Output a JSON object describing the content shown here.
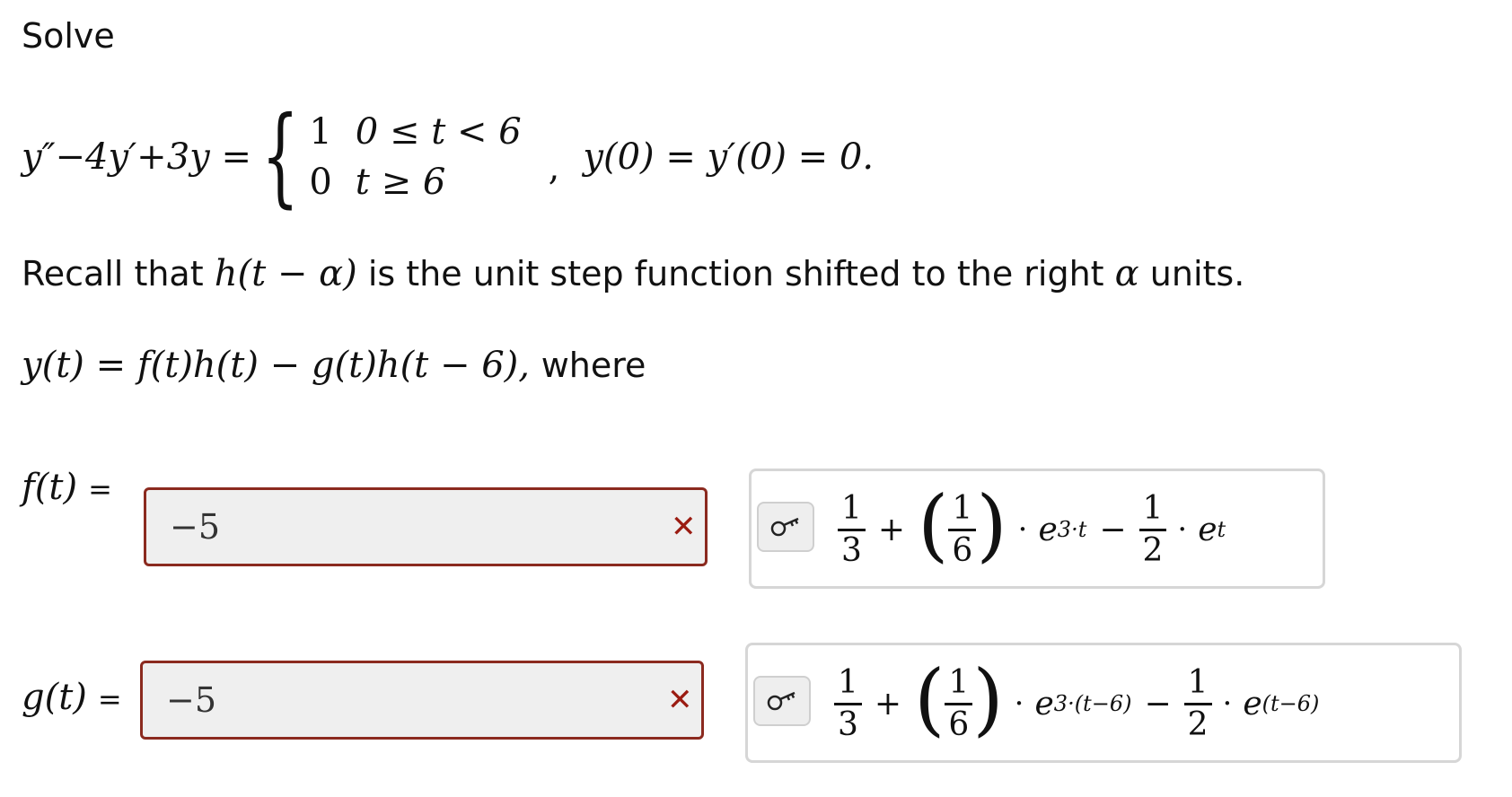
{
  "heading": "Solve",
  "ode": {
    "lhs": "y″−4y′+3y =",
    "cases": [
      {
        "value": "1",
        "condition": "0 ≤ t < 6"
      },
      {
        "value": "0",
        "condition": "t ≥ 6"
      }
    ],
    "separator": ",",
    "initial_conditions": "y(0) = y′(0) = 0."
  },
  "recall": {
    "prefix": "Recall that",
    "function": "h(t − α)",
    "middle": "is the unit step function shifted to the right",
    "alpha": "α",
    "suffix": "units."
  },
  "solution_form": {
    "expression": "y(t) = f(t)h(t) − g(t)h(t − 6),",
    "where": "where"
  },
  "rows": [
    {
      "label": "f(t)",
      "equals": "=",
      "input_value": "−5",
      "status_mark": "✕",
      "answer": {
        "frac1_num": "1",
        "frac1_den": "3",
        "plus": "+",
        "frac2_num": "1",
        "frac2_den": "6",
        "dot1": "·",
        "exp1_base": "e",
        "exp1_power": "3·t",
        "minus": "−",
        "frac3_num": "1",
        "frac3_den": "2",
        "dot2": "·",
        "exp2_base": "e",
        "exp2_power": "t"
      }
    },
    {
      "label": "g(t)",
      "equals": "=",
      "input_value": "−5",
      "status_mark": "✕",
      "answer": {
        "frac1_num": "1",
        "frac1_den": "3",
        "plus": "+",
        "frac2_num": "1",
        "frac2_den": "6",
        "dot1": "·",
        "exp1_base": "e",
        "exp1_power": "3·(t−6)",
        "minus": "−",
        "frac3_num": "1",
        "frac3_den": "2",
        "dot2": "·",
        "exp2_base": "e",
        "exp2_power": "(t−6)"
      }
    }
  ],
  "icons": {
    "key": "key-icon",
    "wrong": "wrong-x-icon"
  },
  "colors": {
    "error_border": "#8b2a1f",
    "error_mark": "#9b1c12",
    "input_bg": "#efefef",
    "key_box_border": "#d6d6d6"
  }
}
